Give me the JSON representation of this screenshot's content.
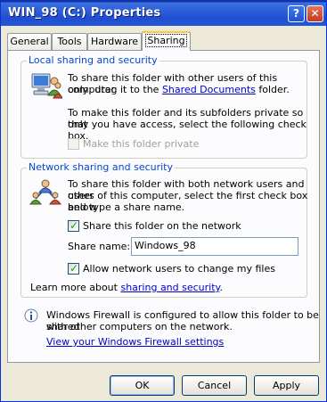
{
  "window": {
    "title": "WIN_98 (C:) Properties",
    "help_glyph": "?",
    "close_glyph": "✕"
  },
  "tabs": [
    {
      "label": "General"
    },
    {
      "label": "Tools"
    },
    {
      "label": "Hardware"
    },
    {
      "label": "Sharing"
    }
  ],
  "local": {
    "title": "Local sharing and security",
    "desc1_line1": "To share this folder with other users of this computer",
    "desc1_pre": "only, drag it to the ",
    "desc1_link": "Shared Documents",
    "desc1_post": " folder.",
    "desc2_line1": "To make this folder and its subfolders private so that",
    "desc2_line2": "only you have access, select the following check box.",
    "private_label": "Make this folder private"
  },
  "network": {
    "title": "Network sharing and security",
    "desc_line1": "To share this folder with both network users and other",
    "desc_line2": "users of this computer, select the first check box below",
    "desc_line3": "and type a share name.",
    "share_checkbox_label": "Share this folder on the network",
    "share_name_label": "Share name:",
    "share_name_value": "Windows_98",
    "allow_change_label": "Allow network users to change my files",
    "learn_more_pre": "Learn more about ",
    "learn_more_link": "sharing and security",
    "learn_more_post": "."
  },
  "firewall": {
    "line1": "Windows Firewall is configured to allow this folder to be shared",
    "line2": "with other computers on the network.",
    "link": "View your Windows Firewall settings"
  },
  "buttons": {
    "ok": "OK",
    "cancel": "Cancel",
    "apply": "Apply"
  },
  "colors": {
    "title_bar": "#2c5bd6",
    "group_title": "#0046d5",
    "link": "#0000cc",
    "dialog_bg": "#ece9d8"
  },
  "icons": [
    "help-icon",
    "close-icon",
    "computer-users-icon",
    "network-share-icon",
    "info-icon",
    "checkmark-icon"
  ]
}
